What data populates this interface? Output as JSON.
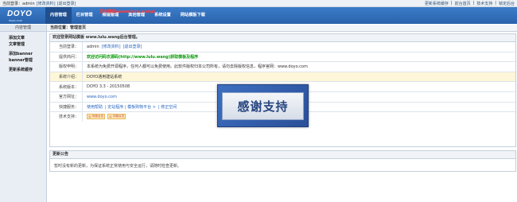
{
  "topbar": {
    "greeting": "当前登录：admin",
    "edit_profile": "[修改资料]",
    "logout": "[退出登录]",
    "links": [
      "更新系统缓存",
      "前台首页",
      "技术支持",
      "锁定后台"
    ]
  },
  "header": {
    "logo": "DOYO",
    "logo_sub": "doyo.com",
    "notice": "更多模板(www.lulu.wang)",
    "nav": [
      "内容管理",
      "栏目管理",
      "频道管理",
      "其他管理",
      "系统设置",
      "网站模板下载"
    ],
    "active_index": 0
  },
  "sidebar": {
    "title": "内容管理",
    "groups": [
      {
        "title": "添加文章",
        "sub": "文章管理"
      },
      {
        "title": "添加banner",
        "sub": "banner管理"
      },
      {
        "title": "更新系统缓存",
        "sub": ""
      }
    ]
  },
  "breadcrumb": "当前位置：管理首页",
  "welcome": {
    "title": "欢迎登录网站模板 www.lulu.wang后台管理。",
    "rows": [
      {
        "label": "当前登录：",
        "value": "admin",
        "links": [
          "[修改资料]",
          "[退出登录]"
        ]
      },
      {
        "label": "提供商问：",
        "value": "欢迎访问码农源码(http://www.lulu.wang)获取模板及程序",
        "style": "green"
      },
      {
        "label": "版权申明：",
        "value": "本系统为免费开源程序，任何人都可以免费使用。此软件版权归本公司所有，请勿去除版权信息，程序官网：www.doyo.com"
      },
      {
        "label": "系统介绍：",
        "value": "DOYO通用建站系统",
        "highlight": true
      },
      {
        "label": "系统版本：",
        "value": "DOYO 3.3 - 20150508"
      },
      {
        "label": "官方网址：",
        "value": "www.doyo.com",
        "style": "blue"
      },
      {
        "label": "快捷服务：",
        "links": [
          "使用帮助",
          "| 定站程序 | 模板购物平台 >",
          "| 修正空间"
        ]
      },
      {
        "label": "技术支持：",
        "chips": [
          "问我点击",
          "问我点击"
        ]
      }
    ]
  },
  "updates": {
    "title": "更新公告",
    "body": "暂时没有新的更新，为保证系统正常使用与安全运行，请随时检查更新。"
  },
  "overlay": {
    "text": "感谢支持"
  }
}
